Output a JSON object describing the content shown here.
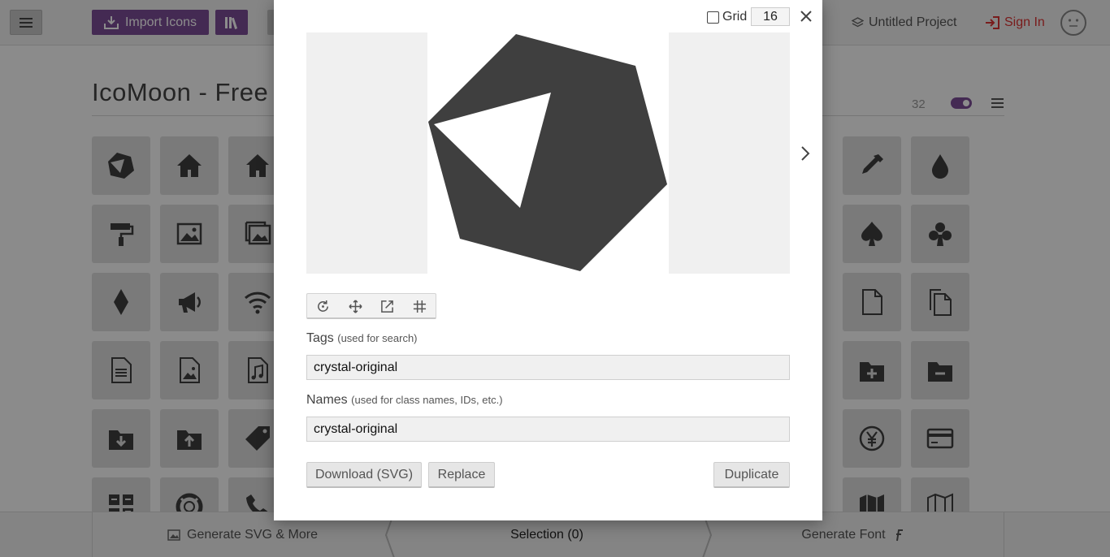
{
  "topbar": {
    "import_label": "Import Icons",
    "project_label": "Untitled Project",
    "signin_label": "Sign In"
  },
  "icon_set": {
    "title": "IcoMoon - Free",
    "count": "32"
  },
  "grid_icons": [
    [
      "crystal-original-icon",
      "home-icon",
      "home2-icon",
      null,
      null,
      "eyedropper-icon",
      "droplet-icon"
    ],
    [
      "paint-roller-icon",
      "image-icon",
      "images-icon",
      null,
      null,
      "spades-icon",
      "clubs-icon"
    ],
    [
      "diamonds-icon",
      "bullhorn-icon",
      "wifi-icon",
      null,
      null,
      "file-empty-icon",
      "files-empty-icon"
    ],
    [
      "file-text-icon",
      "file-picture-icon",
      "file-music-icon",
      null,
      null,
      "folder-plus-icon",
      "folder-minus-icon"
    ],
    [
      "folder-download-icon",
      "folder-upload-icon",
      "price-tag-icon",
      null,
      null,
      "coin-yen-icon",
      "credit-card-icon"
    ],
    [
      "calculator-icon",
      "lifebuoy-icon",
      "phone-icon",
      null,
      null,
      "map-icon",
      "map2-icon"
    ]
  ],
  "bottombar": {
    "generate_svg_label": "Generate SVG & More",
    "selection_label": "Selection (0)",
    "generate_font_label": "Generate Font"
  },
  "modal": {
    "grid_label": "Grid",
    "grid_checked": false,
    "grid_size": "16",
    "tags_label": "Tags",
    "tags_hint": "(used for search)",
    "tags_value": "crystal-original",
    "names_label": "Names",
    "names_hint": "(used for class names, IDs, etc.)",
    "names_value": "crystal-original",
    "download_label": "Download (SVG)",
    "replace_label": "Replace",
    "duplicate_label": "Duplicate",
    "tools": [
      "rotate-icon",
      "move-icon",
      "scale-icon",
      "crop-grid-icon"
    ]
  },
  "colors": {
    "accent": "#7c4d97",
    "signin": "#dd3333",
    "icon_fill": "#3f3f3f"
  }
}
